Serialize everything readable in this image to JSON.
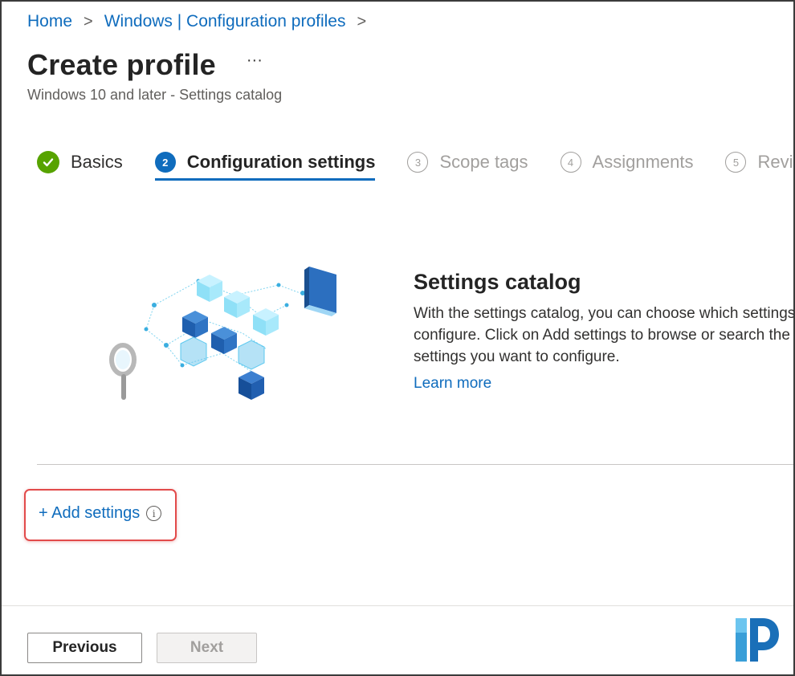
{
  "breadcrumb": {
    "items": [
      "Home",
      "Windows | Configuration profiles"
    ],
    "separator": ">"
  },
  "header": {
    "title": "Create profile",
    "more_label": "···",
    "subtitle": "Windows 10 and later - Settings catalog"
  },
  "steps": [
    {
      "number": "✓",
      "label": "Basics",
      "state": "done"
    },
    {
      "number": "2",
      "label": "Configuration settings",
      "state": "active"
    },
    {
      "number": "3",
      "label": "Scope tags",
      "state": "todo"
    },
    {
      "number": "4",
      "label": "Assignments",
      "state": "todo"
    },
    {
      "number": "5",
      "label": "Review + create",
      "state": "todo"
    }
  ],
  "catalog": {
    "title": "Settings catalog",
    "desc_line1": "With the settings catalog, you can choose which settings you want to",
    "desc_line2": "configure. Click on Add settings to browse or search the catalog for the",
    "desc_line3": "settings you want to configure.",
    "learn_more": "Learn more"
  },
  "add_settings": {
    "label": "+ Add settings",
    "info_icon": "i"
  },
  "footer": {
    "previous": "Previous",
    "next": "Next"
  },
  "colors": {
    "accent": "#0f6cbd",
    "success": "#57a300",
    "highlight": "#e24a4a"
  }
}
